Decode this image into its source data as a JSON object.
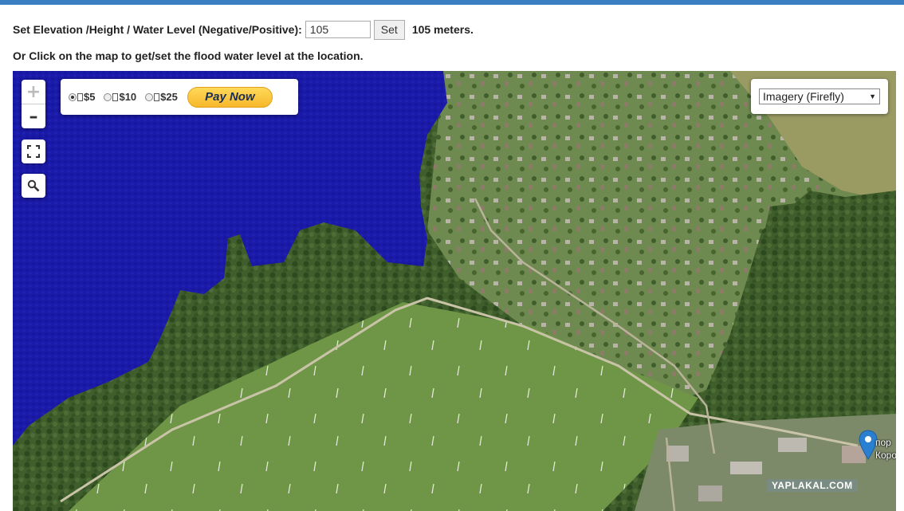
{
  "controls": {
    "label": "Set Elevation /Height / Water Level (Negative/Positive):",
    "input_value": "105",
    "set_button": "Set",
    "result_text": "105 meters."
  },
  "hint": "Or Click on the map to get/set the flood water level at the location.",
  "map": {
    "zoom_in": "+",
    "zoom_out": "–",
    "donation": {
      "options": [
        {
          "label": "$5",
          "selected": true
        },
        {
          "label": "$10",
          "selected": false
        },
        {
          "label": "$25",
          "selected": false
        }
      ],
      "pay_button": "Pay Now"
    },
    "layer_select": {
      "selected": "Imagery (Firefly)"
    },
    "place_label_lines": [
      "пор",
      "Коро"
    ],
    "watermark": "YAPLAKAL.COM",
    "colors": {
      "flood": "#1a1aa8",
      "marker": "#2b7fd0",
      "paypal_button": "#f7b82b",
      "topbar": "#3a7fc1"
    },
    "icons": [
      "fullscreen-icon",
      "search-icon",
      "map-pin-icon",
      "chevron-down-icon"
    ]
  }
}
